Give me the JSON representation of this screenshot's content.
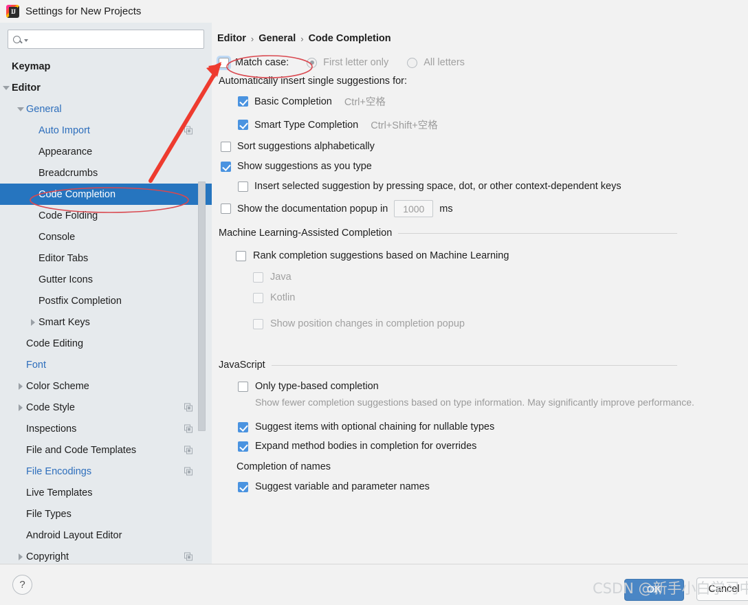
{
  "window": {
    "title": "Settings for New Projects",
    "app_icon": "intellij-idea-icon"
  },
  "sidebar": {
    "search": {
      "value": "",
      "placeholder": ""
    },
    "items": [
      {
        "label": "Keymap",
        "indent": 0,
        "arrow": "none",
        "bold": true,
        "link": false,
        "copy": false,
        "selected": false
      },
      {
        "label": "Editor",
        "indent": 0,
        "arrow": "down",
        "bold": true,
        "link": false,
        "copy": false,
        "selected": false
      },
      {
        "label": "General",
        "indent": 1,
        "arrow": "down",
        "bold": false,
        "link": true,
        "copy": false,
        "selected": false
      },
      {
        "label": "Auto Import",
        "indent": 2,
        "arrow": "none",
        "bold": false,
        "link": true,
        "copy": true,
        "selected": false
      },
      {
        "label": "Appearance",
        "indent": 2,
        "arrow": "none",
        "bold": false,
        "link": false,
        "copy": false,
        "selected": false
      },
      {
        "label": "Breadcrumbs",
        "indent": 2,
        "arrow": "none",
        "bold": false,
        "link": false,
        "copy": false,
        "selected": false
      },
      {
        "label": "Code Completion",
        "indent": 2,
        "arrow": "none",
        "bold": false,
        "link": false,
        "copy": false,
        "selected": true
      },
      {
        "label": "Code Folding",
        "indent": 2,
        "arrow": "none",
        "bold": false,
        "link": false,
        "copy": false,
        "selected": false
      },
      {
        "label": "Console",
        "indent": 2,
        "arrow": "none",
        "bold": false,
        "link": false,
        "copy": false,
        "selected": false
      },
      {
        "label": "Editor Tabs",
        "indent": 2,
        "arrow": "none",
        "bold": false,
        "link": false,
        "copy": false,
        "selected": false
      },
      {
        "label": "Gutter Icons",
        "indent": 2,
        "arrow": "none",
        "bold": false,
        "link": false,
        "copy": false,
        "selected": false
      },
      {
        "label": "Postfix Completion",
        "indent": 2,
        "arrow": "none",
        "bold": false,
        "link": false,
        "copy": false,
        "selected": false
      },
      {
        "label": "Smart Keys",
        "indent": 2,
        "arrow": "right",
        "bold": false,
        "link": false,
        "copy": false,
        "selected": false
      },
      {
        "label": "Code Editing",
        "indent": 1,
        "arrow": "none",
        "bold": false,
        "link": false,
        "copy": false,
        "selected": false
      },
      {
        "label": "Font",
        "indent": 1,
        "arrow": "none",
        "bold": false,
        "link": true,
        "copy": false,
        "selected": false
      },
      {
        "label": "Color Scheme",
        "indent": 1,
        "arrow": "right",
        "bold": false,
        "link": false,
        "copy": false,
        "selected": false
      },
      {
        "label": "Code Style",
        "indent": 1,
        "arrow": "right",
        "bold": false,
        "link": false,
        "copy": true,
        "selected": false
      },
      {
        "label": "Inspections",
        "indent": 1,
        "arrow": "none",
        "bold": false,
        "link": false,
        "copy": true,
        "selected": false
      },
      {
        "label": "File and Code Templates",
        "indent": 1,
        "arrow": "none",
        "bold": false,
        "link": false,
        "copy": true,
        "selected": false
      },
      {
        "label": "File Encodings",
        "indent": 1,
        "arrow": "none",
        "bold": false,
        "link": true,
        "copy": true,
        "selected": false
      },
      {
        "label": "Live Templates",
        "indent": 1,
        "arrow": "none",
        "bold": false,
        "link": false,
        "copy": false,
        "selected": false
      },
      {
        "label": "File Types",
        "indent": 1,
        "arrow": "none",
        "bold": false,
        "link": false,
        "copy": false,
        "selected": false
      },
      {
        "label": "Android Layout Editor",
        "indent": 1,
        "arrow": "none",
        "bold": false,
        "link": false,
        "copy": false,
        "selected": false
      },
      {
        "label": "Copyright",
        "indent": 1,
        "arrow": "right",
        "bold": false,
        "link": false,
        "copy": true,
        "selected": false
      }
    ]
  },
  "breadcrumb": {
    "items": [
      "Editor",
      "General",
      "Code Completion"
    ],
    "separator": "›"
  },
  "main": {
    "match_case": {
      "label": "Match case:",
      "checked": false,
      "focused": true,
      "options": [
        {
          "label": "First letter only",
          "selected": true,
          "disabled": true
        },
        {
          "label": "All letters",
          "selected": false,
          "disabled": true
        }
      ]
    },
    "auto_insert_label": "Automatically insert single suggestions for:",
    "auto_insert_items": [
      {
        "label": "Basic Completion",
        "shortcut": "Ctrl+空格",
        "checked": true
      },
      {
        "label": "Smart Type Completion",
        "shortcut": "Ctrl+Shift+空格",
        "checked": true
      }
    ],
    "sort_alphabetically": {
      "label": "Sort suggestions alphabetically",
      "checked": false
    },
    "show_as_you_type": {
      "label": "Show suggestions as you type",
      "checked": true
    },
    "insert_selected": {
      "label": "Insert selected suggestion by pressing space, dot, or other context-dependent keys",
      "checked": false
    },
    "doc_popup": {
      "prefix": "Show the documentation popup in",
      "value": "1000",
      "unit": "ms",
      "checked": false
    },
    "ml_section": {
      "title": "Machine Learning-Assisted Completion",
      "rank": {
        "label": "Rank completion suggestions based on Machine Learning",
        "checked": false
      },
      "languages": [
        {
          "label": "Java",
          "checked": false,
          "disabled": true
        },
        {
          "label": "Kotlin",
          "checked": false,
          "disabled": true
        }
      ],
      "position_changes": {
        "label": "Show position changes in completion popup",
        "checked": false,
        "disabled": true
      }
    },
    "js_section": {
      "title": "JavaScript",
      "only_type_based": {
        "label": "Only type-based completion",
        "checked": false,
        "mnemonic": "c"
      },
      "only_type_based_desc": "Show fewer completion suggestions based on type information. May significantly improve performance.",
      "optional_chaining": {
        "label": "Suggest items with optional chaining for nullable types",
        "checked": true,
        "mnemonic": "o"
      },
      "expand_method": {
        "label": "Expand method bodies in completion for overrides",
        "checked": true
      },
      "completion_of_names_title": "Completion of names",
      "suggest_variable": {
        "label": "Suggest variable and parameter names",
        "checked": true
      }
    }
  },
  "footer": {
    "help_label": "?",
    "ok_label": "OK",
    "cancel_label": "Cancel"
  },
  "watermark": {
    "text": "CSDN @新手小白学习中"
  },
  "annotations": {
    "accent_color": "#ee3b2f",
    "ellipse_color": "#d9484f",
    "selection_color": "#2675bf",
    "checkbox_on_color": "#4a93e0",
    "link_color": "#2d6ebc"
  }
}
